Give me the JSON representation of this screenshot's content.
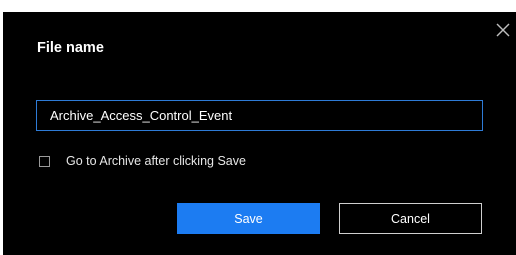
{
  "dialog": {
    "title": "File name",
    "close_icon": "close-icon",
    "filename_value": "Archive_Access_Control_Event",
    "checkbox": {
      "label": "Go to Archive after clicking Save",
      "checked": false
    },
    "buttons": {
      "save_label": "Save",
      "cancel_label": "Cancel"
    }
  },
  "colors": {
    "dialog_background": "#000000",
    "primary_button": "#1c7cf2",
    "input_border": "#2e7bd6",
    "text": "#ffffff"
  }
}
